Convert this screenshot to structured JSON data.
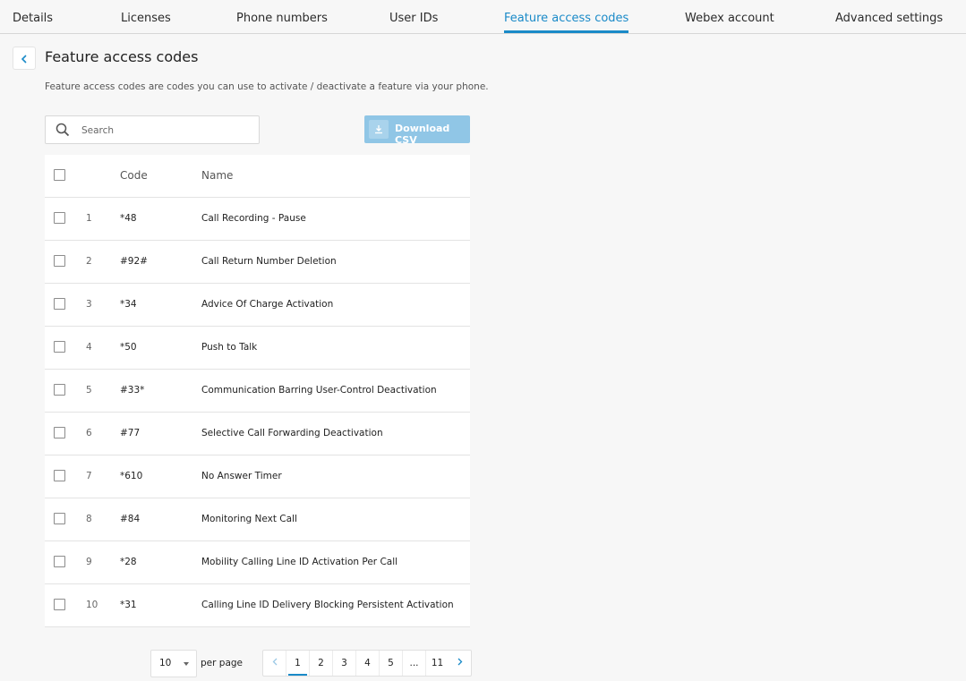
{
  "tabs": [
    {
      "label": "Details"
    },
    {
      "label": "Licenses"
    },
    {
      "label": "Phone numbers"
    },
    {
      "label": "User IDs"
    },
    {
      "label": "Feature access codes"
    },
    {
      "label": "Webex account"
    },
    {
      "label": "Advanced settings"
    }
  ],
  "active_tab": "Feature access codes",
  "header": {
    "title": "Feature access codes",
    "description": "Feature access codes are codes you can use to activate / deactivate a feature via your phone."
  },
  "search": {
    "placeholder": "Search",
    "value": ""
  },
  "download_button": {
    "label": "Download CSV"
  },
  "table": {
    "columns": {
      "code": "Code",
      "name": "Name"
    },
    "rows": [
      {
        "num": "1",
        "code": "*48",
        "name": "Call Recording - Pause"
      },
      {
        "num": "2",
        "code": "#92#",
        "name": "Call Return Number Deletion"
      },
      {
        "num": "3",
        "code": "*34",
        "name": "Advice Of Charge Activation"
      },
      {
        "num": "4",
        "code": "*50",
        "name": "Push to Talk"
      },
      {
        "num": "5",
        "code": "#33*",
        "name": "Communication Barring User-Control Deactivation"
      },
      {
        "num": "6",
        "code": "#77",
        "name": "Selective Call Forwarding Deactivation"
      },
      {
        "num": "7",
        "code": "*610",
        "name": "No Answer Timer"
      },
      {
        "num": "8",
        "code": "#84",
        "name": "Monitoring Next Call"
      },
      {
        "num": "9",
        "code": "*28",
        "name": "Mobility Calling Line ID Activation Per Call"
      },
      {
        "num": "10",
        "code": "*31",
        "name": "Calling Line ID Delivery Blocking Persistent Activation"
      }
    ]
  },
  "pagination": {
    "per_page_value": "10",
    "per_page_label": "per page",
    "pages": [
      "1",
      "2",
      "3",
      "4",
      "5",
      "...",
      "11"
    ],
    "current_page": "1"
  },
  "colors": {
    "accent": "#1a8ac8",
    "download_bg": "#90c6e6"
  }
}
